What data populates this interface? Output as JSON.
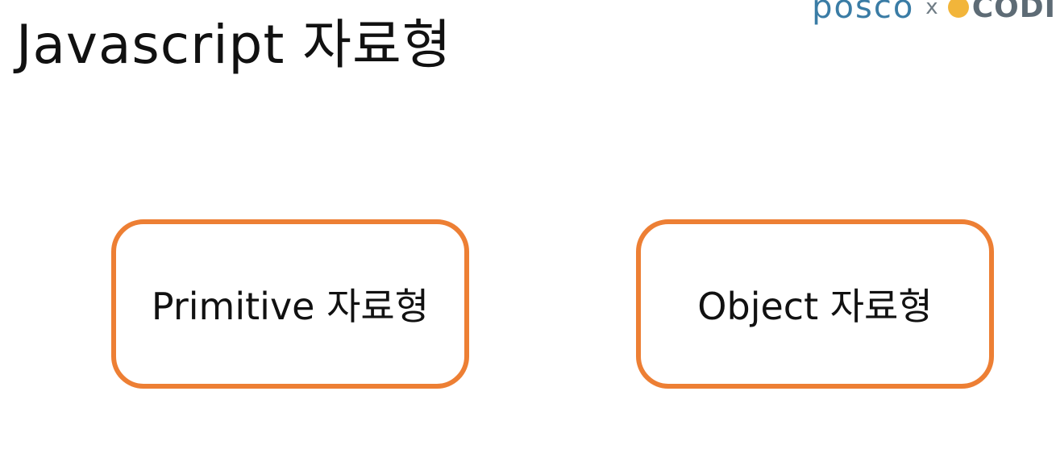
{
  "title": "Javascript 자료형",
  "logo": {
    "brand": "posco",
    "separator": "x",
    "partner": "CODI"
  },
  "boxes": [
    {
      "label": "Primitive 자료형"
    },
    {
      "label": "Object 자료형"
    }
  ],
  "colors": {
    "box_border": "#ed7f34",
    "text": "#111111",
    "posco_blue": "#3a7ca5",
    "codi_yellow": "#f2b53a"
  }
}
